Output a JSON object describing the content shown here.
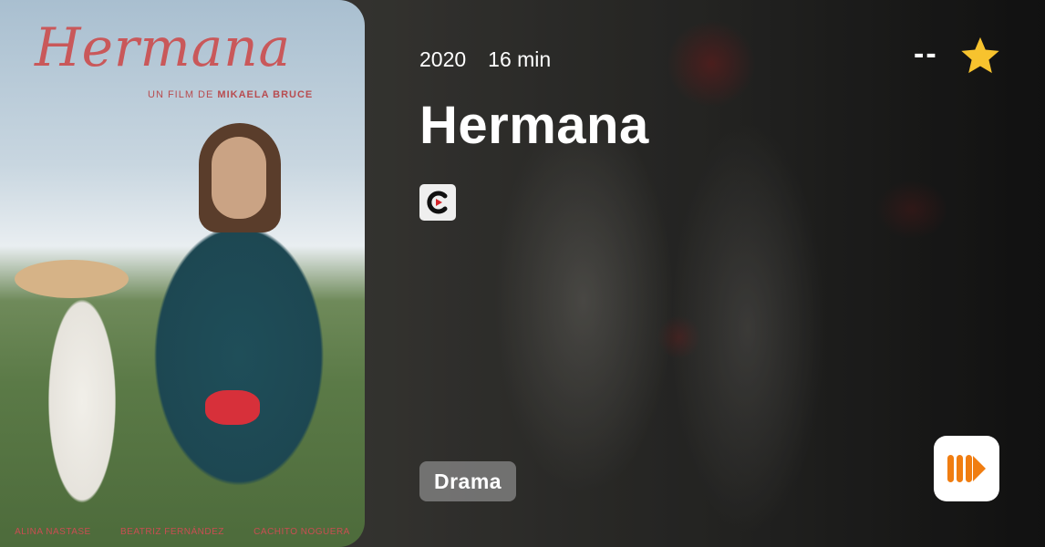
{
  "poster": {
    "title": "Hermana",
    "credit_prefix": "UN FILM DE",
    "credit_name": "MIKAELA BRUCE",
    "cast": [
      "ALINA NASTASE",
      "BEATRIZ FERNÁNDEZ",
      "CACHITO NOGUERA"
    ]
  },
  "movie": {
    "year": "2020",
    "runtime": "16 min",
    "title": "Hermana",
    "rating": "--",
    "genre": "Drama"
  },
  "icons": {
    "provider": "provider-c-logo-icon",
    "rating": "star-icon",
    "app": "play-app-icon"
  },
  "colors": {
    "star": "#f7c32e",
    "app_accent": "#f07d11",
    "provider_red": "#d4242a"
  }
}
